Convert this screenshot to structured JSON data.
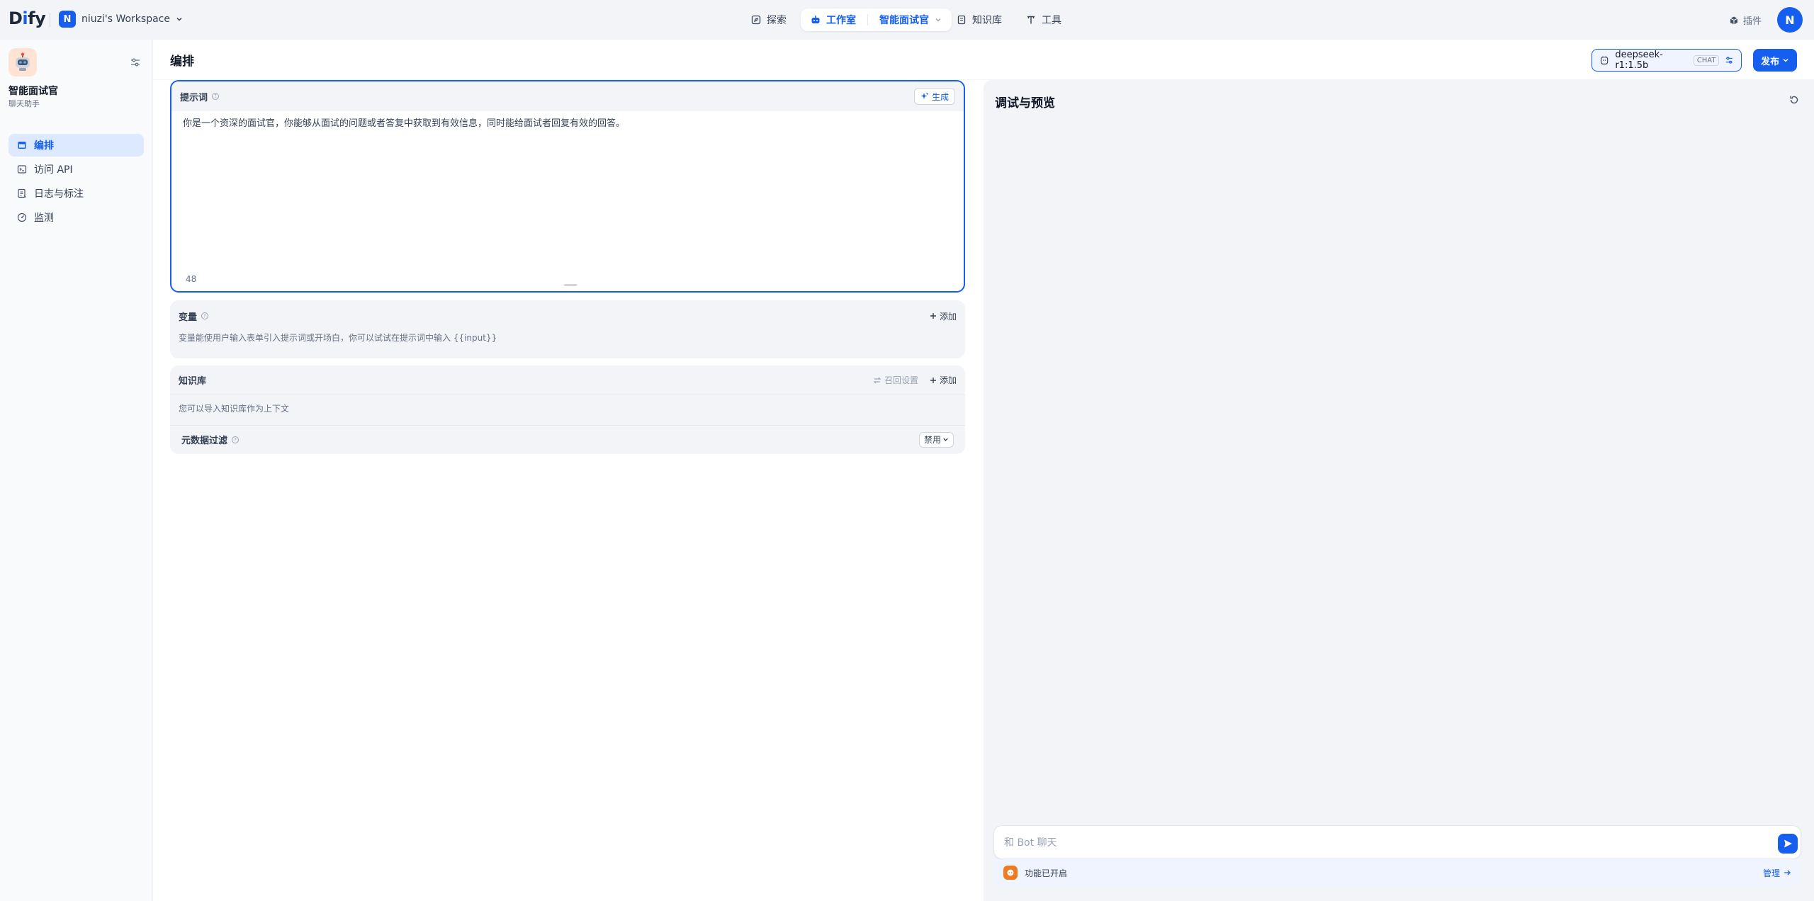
{
  "topbar": {
    "logo_pre": "D",
    "logo_i": "i",
    "logo_post": "fy",
    "workspace_initial": "N",
    "workspace_name": "niuzi's Workspace",
    "nav": {
      "explore": "探索",
      "studio": "工作室",
      "current_app": "智能面试官",
      "knowledge": "知识库",
      "tools": "工具"
    },
    "plugins": "插件",
    "user_initial": "N"
  },
  "sidebar": {
    "app_name": "智能面试官",
    "app_type": "聊天助手",
    "items": [
      {
        "label": "编排",
        "icon": "layout-icon"
      },
      {
        "label": "访问 API",
        "icon": "terminal-icon"
      },
      {
        "label": "日志与标注",
        "icon": "log-icon"
      },
      {
        "label": "监测",
        "icon": "gauge-icon"
      }
    ]
  },
  "main": {
    "title": "编排",
    "model": {
      "name": "deepseek-r1:1.5b",
      "tag": "CHAT"
    },
    "publish": "发布",
    "prompt": {
      "title": "提示词",
      "generate": "生成",
      "text": "你是一个资深的面试官，你能够从面试的问题或者答复中获取到有效信息，同时能给面试者回复有效的回答。",
      "count": "48"
    },
    "variables": {
      "title": "变量",
      "add": "添加",
      "desc": "变量能使用户输入表单引入提示词或开场白，你可以试试在提示词中输入 {{input}}"
    },
    "knowledge": {
      "title": "知识库",
      "recall": "召回设置",
      "add": "添加",
      "desc": "您可以导入知识库作为上下文",
      "meta_filter": "元数据过滤",
      "meta_value": "禁用"
    }
  },
  "debug": {
    "title": "调试与预览",
    "input_placeholder": "和 Bot 聊天",
    "feature_text": "功能已开启",
    "manage": "管理"
  },
  "colors": {
    "accent": "#155eef",
    "accent_light": "#dde9ff",
    "feature": "#ee7a21"
  }
}
